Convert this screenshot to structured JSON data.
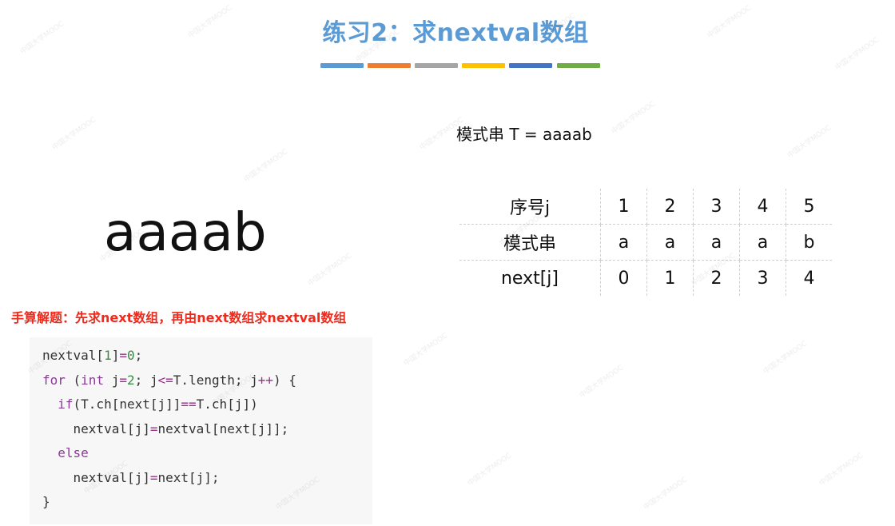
{
  "title": "练习2：求nextval数组",
  "color_bar": [
    "#5b9bd5",
    "#ed7d31",
    "#a5a5a5",
    "#ffc000",
    "#4472c4",
    "#70ad47"
  ],
  "pattern_label": "模式串 T = aaaab",
  "big_word": "aaaab",
  "hand_calc_note": "手算解题：先求next数组，再由next数组求nextval数组",
  "table": {
    "rows": [
      {
        "label": "序号j",
        "values": [
          "1",
          "2",
          "3",
          "4",
          "5"
        ]
      },
      {
        "label": "模式串",
        "values": [
          "a",
          "a",
          "a",
          "a",
          "b"
        ]
      },
      {
        "label": "next[j]",
        "values": [
          "0",
          "1",
          "2",
          "3",
          "4"
        ]
      }
    ]
  },
  "code": {
    "lines": [
      [
        {
          "t": "nextval[",
          "c": "pl"
        },
        {
          "t": "1",
          "c": "num"
        },
        {
          "t": "]",
          "c": "pl"
        },
        {
          "t": "=",
          "c": "op"
        },
        {
          "t": "0",
          "c": "num"
        },
        {
          "t": ";",
          "c": "pl"
        }
      ],
      [
        {
          "t": "for",
          "c": "kw"
        },
        {
          "t": " (",
          "c": "pl"
        },
        {
          "t": "int",
          "c": "kw"
        },
        {
          "t": " j",
          "c": "pl"
        },
        {
          "t": "=",
          "c": "op"
        },
        {
          "t": "2",
          "c": "num"
        },
        {
          "t": "; j",
          "c": "pl"
        },
        {
          "t": "<=",
          "c": "op"
        },
        {
          "t": "T.length; j",
          "c": "pl"
        },
        {
          "t": "++",
          "c": "op"
        },
        {
          "t": ") {",
          "c": "pl"
        }
      ],
      [
        {
          "t": "  ",
          "c": "pl"
        },
        {
          "t": "if",
          "c": "kw"
        },
        {
          "t": "(T.ch[next[j]]",
          "c": "pl"
        },
        {
          "t": "==",
          "c": "op"
        },
        {
          "t": "T.ch[j])",
          "c": "pl"
        }
      ],
      [
        {
          "t": "    nextval[j]",
          "c": "pl"
        },
        {
          "t": "=",
          "c": "op"
        },
        {
          "t": "nextval[next[j]];",
          "c": "pl"
        }
      ],
      [
        {
          "t": "  ",
          "c": "pl"
        },
        {
          "t": "else",
          "c": "kw"
        }
      ],
      [
        {
          "t": "    nextval[j]",
          "c": "pl"
        },
        {
          "t": "=",
          "c": "op"
        },
        {
          "t": "next[j];",
          "c": "pl"
        }
      ],
      [
        {
          "t": "}",
          "c": "pl"
        }
      ]
    ]
  },
  "watermark_text": "中国大学MOOC"
}
